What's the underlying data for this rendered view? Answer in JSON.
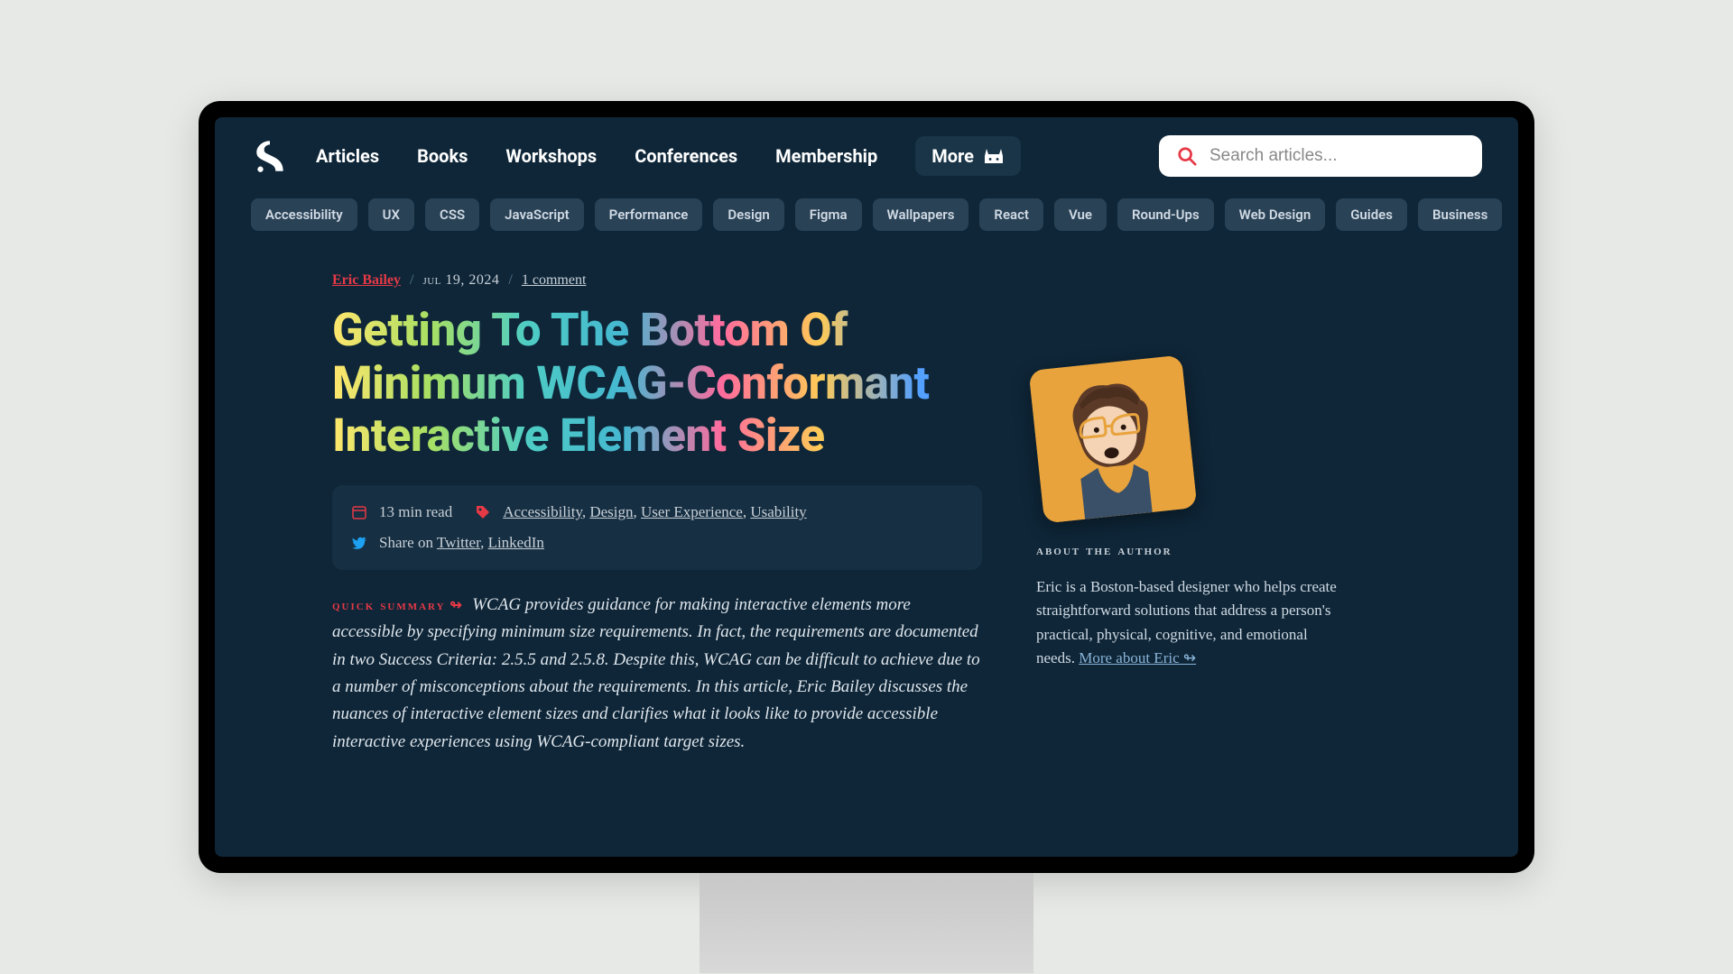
{
  "nav": {
    "main": [
      "Articles",
      "Books",
      "Workshops",
      "Conferences",
      "Membership"
    ],
    "more": "More"
  },
  "search": {
    "placeholder": "Search articles..."
  },
  "tags": [
    "Accessibility",
    "UX",
    "CSS",
    "JavaScript",
    "Performance",
    "Design",
    "Figma",
    "Wallpapers",
    "React",
    "Vue",
    "Round-Ups",
    "Web Design",
    "Guides",
    "Business"
  ],
  "article": {
    "author": "Eric Bailey",
    "date": "jul 19, 2024",
    "comments": "1 comment",
    "title": "Getting To The Bottom Of Minimum WCAG-Conformant Interactive Element Size",
    "read_time": "13 min read",
    "topics": [
      "Accessibility",
      "Design",
      "User Experience",
      "Usability"
    ],
    "share_prefix": "Share on ",
    "share": [
      "Twitter",
      "LinkedIn"
    ],
    "summary_label": "quick summary",
    "summary_arrow": "↬",
    "summary": "WCAG provides guidance for making interactive elements more accessible by specifying minimum size requirements. In fact, the requirements are documented in two Success Criteria: 2.5.5 and 2.5.8. Despite this, WCAG can be difficult to achieve due to a number of misconceptions about the requirements. In this article, Eric Bailey discusses the nuances of interactive element sizes and clarifies what it looks like to provide accessible interactive experiences using WCAG-compliant target sizes."
  },
  "sidebar": {
    "about_heading": "about the author",
    "about_text": "Eric is a Boston-based designer who helps create straightforward solutions that address a person's practical, physical, cognitive, and emotional needs. ",
    "about_link": "More about Eric ↬"
  }
}
